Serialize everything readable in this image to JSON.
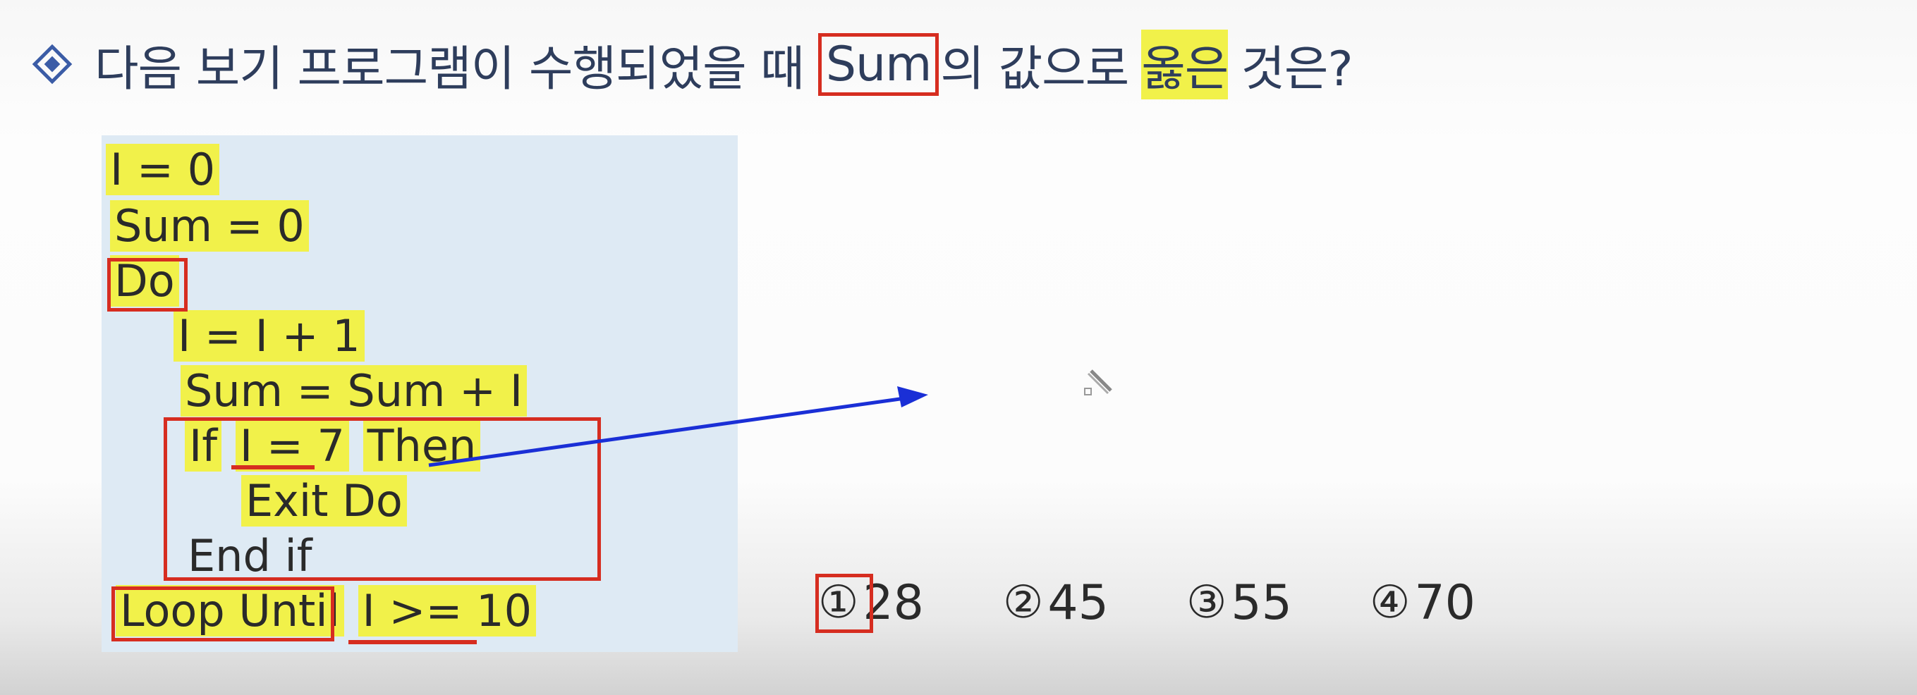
{
  "question": {
    "prefix": "다음 보기 프로그램이 수행되었을 때",
    "boxed_word": "Sum",
    "middle": "의 값으로",
    "highlight_word": "옳은",
    "suffix": "것은?"
  },
  "code": {
    "lines": [
      "I = 0",
      "Sum = 0",
      "Do",
      "I = I + 1",
      "Sum = Sum + I",
      "If",
      "I = 7",
      "Then",
      "Exit Do",
      "End if",
      "Loop Until",
      "I >= 10"
    ]
  },
  "choices": [
    {
      "num": "①",
      "value": "28"
    },
    {
      "num": "②",
      "value": "45"
    },
    {
      "num": "③",
      "value": "55"
    },
    {
      "num": "④",
      "value": "70"
    }
  ],
  "colors": {
    "annotation_red": "#d62d20",
    "highlight_yellow": "#f1f14a",
    "arrow_blue": "#1a2fd6",
    "code_panel_bg": "#deeaf4",
    "title_color": "#2e3d5c"
  }
}
